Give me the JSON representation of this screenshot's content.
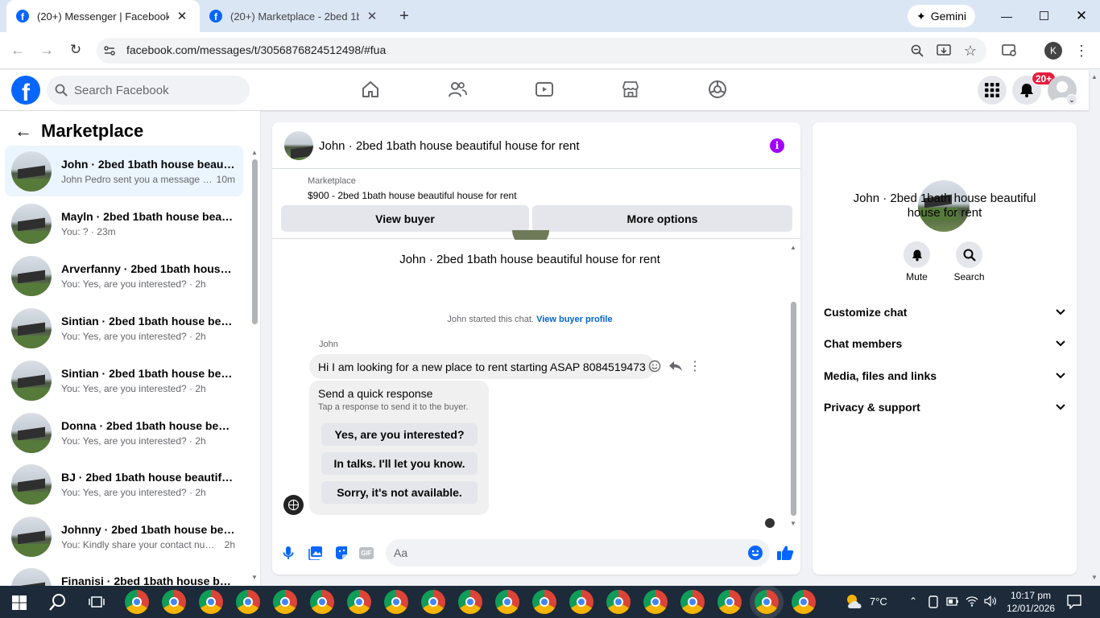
{
  "browser": {
    "tabs": [
      {
        "title": "(20+) Messenger | Facebook",
        "active": true
      },
      {
        "title": "(20+) Marketplace - 2bed 1bath",
        "active": false
      }
    ],
    "new_tab": "+",
    "gemini_label": "Gemini",
    "url": "facebook.com/messages/t/3056876824512498/#fua",
    "profile_initial": "K"
  },
  "fb": {
    "logo": "f",
    "search_placeholder": "Search Facebook",
    "notifications_badge": "20+"
  },
  "sidebar": {
    "title": "Marketplace",
    "conversations": [
      {
        "name": "John · 2bed 1bath house beautiful house for rent",
        "preview": "John Pedro sent you a message a...",
        "time": "10m",
        "active": true
      },
      {
        "name": "Mayln · 2bed 1bath house beautiful house for rent",
        "preview": "You: ?",
        "time": "23m",
        "active": false
      },
      {
        "name": "Arverfanny · 2bed 1bath house beautiful house for rent",
        "preview": "You: Yes, are you interested?",
        "time": "2h",
        "active": false
      },
      {
        "name": "Sintian · 2bed 1bath house beautiful house for rent",
        "preview": "You: Yes, are you interested?",
        "time": "2h",
        "active": false
      },
      {
        "name": "Sintian · 2bed 1bath house beautiful house for rent",
        "preview": "You: Yes, are you interested?",
        "time": "2h",
        "active": false
      },
      {
        "name": "Donna · 2bed 1bath house beautiful house for rent",
        "preview": "You: Yes, are you interested?",
        "time": "2h",
        "active": false
      },
      {
        "name": "BJ · 2bed 1bath house beautiful house for rent",
        "preview": "You: Yes, are you interested?",
        "time": "2h",
        "active": false
      },
      {
        "name": "Johnny · 2bed 1bath house beautiful house for rent",
        "preview": "You: Kindly share your contact num...",
        "time": "2h",
        "active": false
      },
      {
        "name": "Finanisi · 2bed 1bath house beautiful house for rent",
        "preview": "",
        "time": "",
        "active": false
      }
    ]
  },
  "chat": {
    "header_title": "John · 2bed 1bath house beautiful house for rent",
    "listing_label": "Marketplace",
    "listing_price_title": "$900 - 2bed 1bath house beautiful house for rent",
    "view_buyer": "View buyer",
    "more_options": "More options",
    "intro_name": "John · 2bed 1bath house beautiful house for rent",
    "started_text": "John started this chat.",
    "view_buyer_profile": "View buyer profile",
    "sender": "John",
    "message": "Hi I am looking for a new place to rent starting ASAP 8084519473",
    "quick_title": "Send a quick response",
    "quick_subtitle": "Tap a response to send it to the buyer.",
    "quick_responses": [
      "Yes, are you interested?",
      "In talks. I'll let you know.",
      "Sorry, it's not available."
    ],
    "composer_placeholder": "Aa",
    "gif_label": "GIF"
  },
  "details": {
    "title": "John · 2bed 1bath house beautiful house for rent",
    "mute": "Mute",
    "search": "Search",
    "sections": [
      "Customize chat",
      "Chat members",
      "Media, files and links",
      "Privacy & support"
    ]
  },
  "taskbar": {
    "weather": "7°C",
    "time": "10:17 pm",
    "date": "12/01/2026"
  },
  "colors": {
    "fb_blue": "#0866ff",
    "badge_red": "#e41e3f",
    "info_purple": "#a100ff"
  }
}
